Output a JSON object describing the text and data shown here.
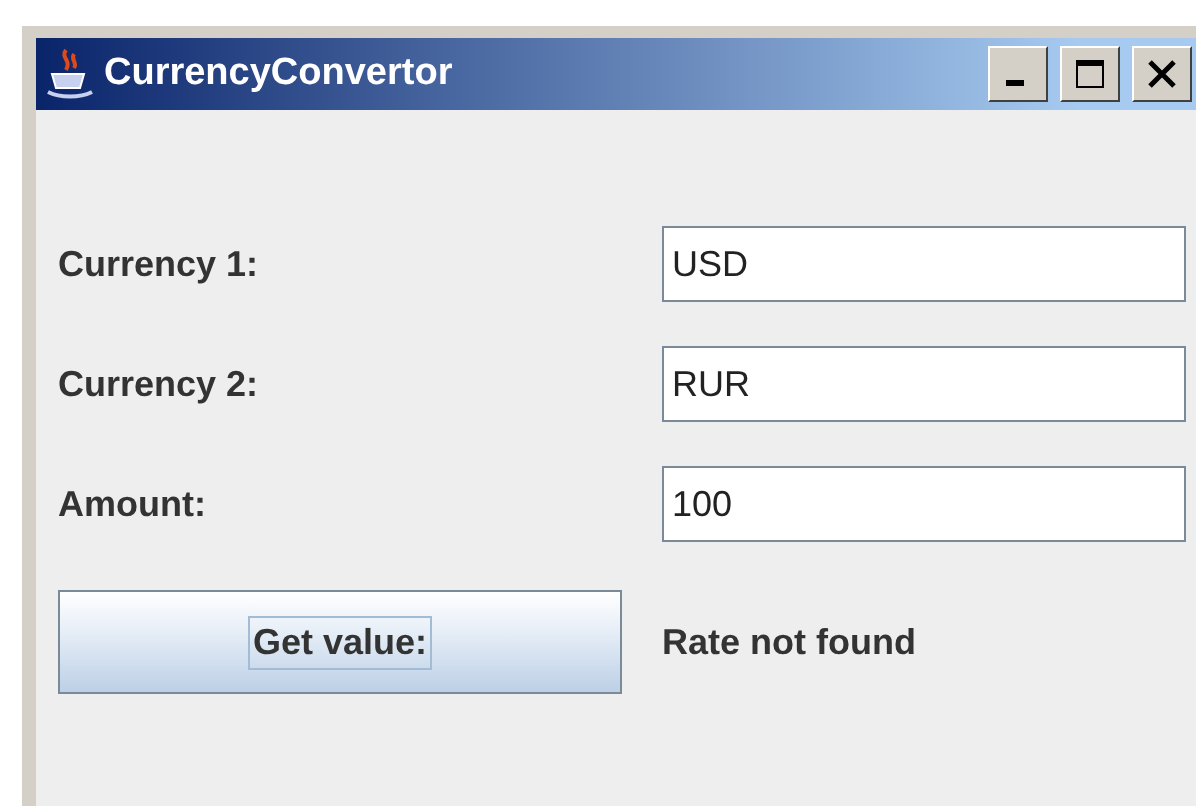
{
  "window": {
    "title": "CurrencyConvertor"
  },
  "fields": [
    {
      "label": "Currency 1:",
      "value": "USD"
    },
    {
      "label": "Currency 2:",
      "value": "RUR"
    },
    {
      "label": "Amount:",
      "value": "100"
    }
  ],
  "button": {
    "label": "Get value:"
  },
  "result": "Rate not found"
}
